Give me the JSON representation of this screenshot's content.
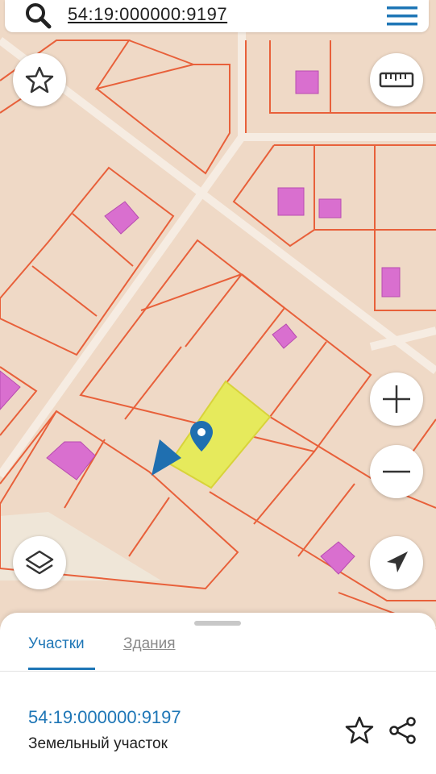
{
  "search": {
    "query": "54:19:000000:9197"
  },
  "icons": {
    "search": "search-icon",
    "menu": "hamburger-menu-icon",
    "favorite": "star-icon",
    "ruler": "ruler-icon",
    "zoom_in": "plus-icon",
    "zoom_out": "minus-icon",
    "layers": "layers-icon",
    "locate": "navigation-arrow-icon",
    "marker": "map-pin-icon",
    "share": "share-icon"
  },
  "colors": {
    "accent": "#1e76b6",
    "parcel_border": "#e8603a",
    "selected_parcel": "#e6ea5c",
    "building": "#d96fcf",
    "map_background": "#efd9c6"
  },
  "sheet": {
    "tabs": [
      {
        "label": "Участки",
        "active": true
      },
      {
        "label": "Здания",
        "active": false
      }
    ],
    "parcel": {
      "number": "54:19:000000:9197",
      "type": "Земельный участок"
    }
  }
}
